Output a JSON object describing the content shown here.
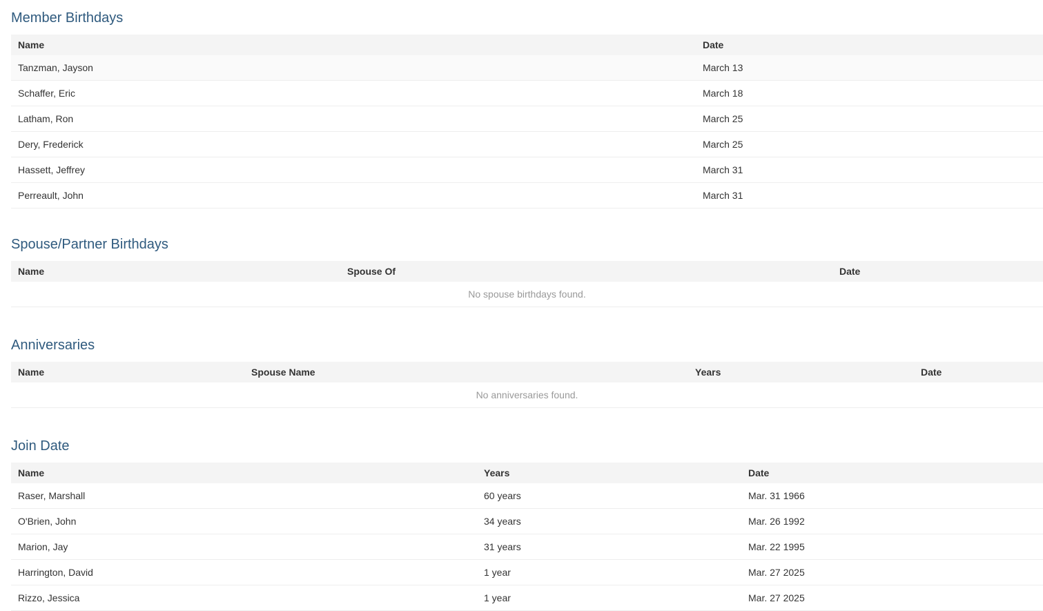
{
  "member_birthdays": {
    "title": "Member Birthdays",
    "columns": [
      "Name",
      "Date"
    ],
    "rows": [
      [
        "Tanzman, Jayson",
        "March 13"
      ],
      [
        "Schaffer, Eric",
        "March 18"
      ],
      [
        "Latham, Ron",
        "March 25"
      ],
      [
        "Dery, Frederick",
        "March 25"
      ],
      [
        "Hassett, Jeffrey",
        "March 31"
      ],
      [
        "Perreault, John",
        "March 31"
      ]
    ]
  },
  "spouse_birthdays": {
    "title": "Spouse/Partner Birthdays",
    "columns": [
      "Name",
      "Spouse Of",
      "Date"
    ],
    "empty_message": "No spouse birthdays found."
  },
  "anniversaries": {
    "title": "Anniversaries",
    "columns": [
      "Name",
      "Spouse Name",
      "Years",
      "Date"
    ],
    "empty_message": "No anniversaries found."
  },
  "join_date": {
    "title": "Join Date",
    "columns": [
      "Name",
      "Years",
      "Date"
    ],
    "rows": [
      [
        "Raser, Marshall",
        "60 years",
        "Mar. 31 1966"
      ],
      [
        "O'Brien, John",
        "34 years",
        "Mar. 26 1992"
      ],
      [
        "Marion, Jay",
        "31 years",
        "Mar. 22 1995"
      ],
      [
        "Harrington, David",
        "1 year",
        "Mar. 27 2025"
      ],
      [
        "Rizzo, Jessica",
        "1 year",
        "Mar. 27 2025"
      ]
    ]
  }
}
